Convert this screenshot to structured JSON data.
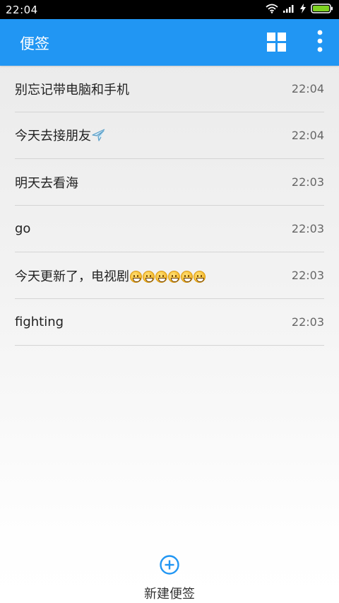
{
  "status_bar": {
    "time": "22:04",
    "icons": [
      "wifi-icon",
      "signal-icon",
      "charging-icon",
      "battery-icon"
    ],
    "battery_color": "#7ed321"
  },
  "app_bar": {
    "title": "便签",
    "background": "#2196f3",
    "actions": [
      "grid-view-icon",
      "more-options-icon"
    ]
  },
  "notes": [
    {
      "title": "别忘记带电脑和手机",
      "time": "22:04"
    },
    {
      "title": "今天去接朋友",
      "time": "22:04",
      "trailing_icon": "airplane-icon"
    },
    {
      "title": "明天去看海",
      "time": "22:03"
    },
    {
      "title": "go",
      "time": "22:03"
    },
    {
      "title": "今天更新了，电视剧",
      "time": "22:03",
      "trailing_icon": "smiley-emoji",
      "trailing_icon_count": 6
    },
    {
      "title": "fighting",
      "time": "22:03"
    }
  ],
  "new_note": {
    "label": "新建便签",
    "icon": "add-circle-icon",
    "accent": "#2196f3"
  }
}
